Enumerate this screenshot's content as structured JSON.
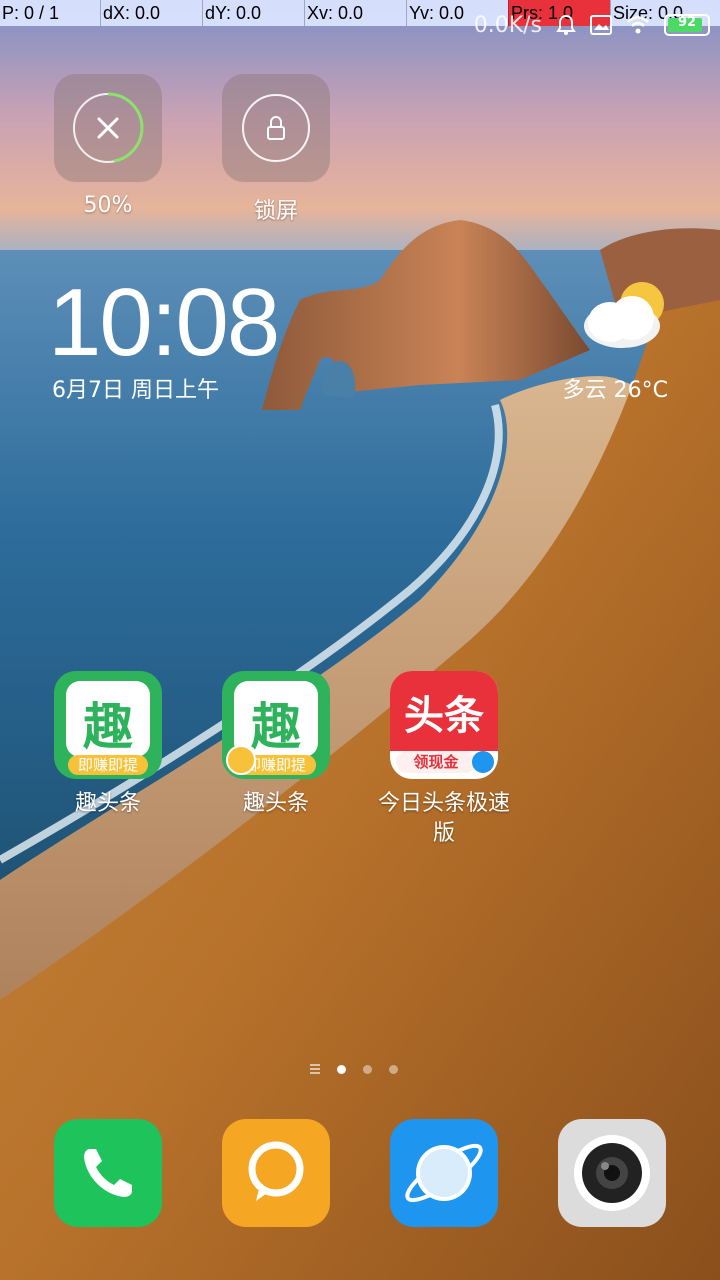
{
  "dev_overlay": {
    "pointer": "P: 0 / 1",
    "dx": "dX: 0.0",
    "dy": "dY: 0.0",
    "xv": "Xv: 0.0",
    "yv": "Yv: 0.0",
    "prs": "Prs: 1.0",
    "size": "Size: 0.0"
  },
  "status_bar": {
    "network_speed": "0.0K/s",
    "battery_level": "92"
  },
  "quick_widgets": [
    {
      "label": "50%",
      "icon": "clean-memory-icon"
    },
    {
      "label": "锁屏",
      "icon": "lock-icon"
    }
  ],
  "clock": {
    "time": "10:08",
    "date": "6月7日 周日上午"
  },
  "weather": {
    "text": "多云  26°C",
    "icon": "partly-cloudy-icon"
  },
  "apps": [
    {
      "label": "趣头条",
      "badge": "即赚即提"
    },
    {
      "label": "趣头条",
      "badge": "即赚即提"
    },
    {
      "label": "今日头条极速版",
      "title": "头条",
      "badge": "领现金"
    }
  ],
  "dock": [
    {
      "icon": "phone-icon",
      "color": "#1ec35b"
    },
    {
      "icon": "messages-icon",
      "color": "#f5a623"
    },
    {
      "icon": "browser-icon",
      "color": "#1e96f0"
    },
    {
      "icon": "camera-icon",
      "color": "#d8d8d8"
    }
  ]
}
